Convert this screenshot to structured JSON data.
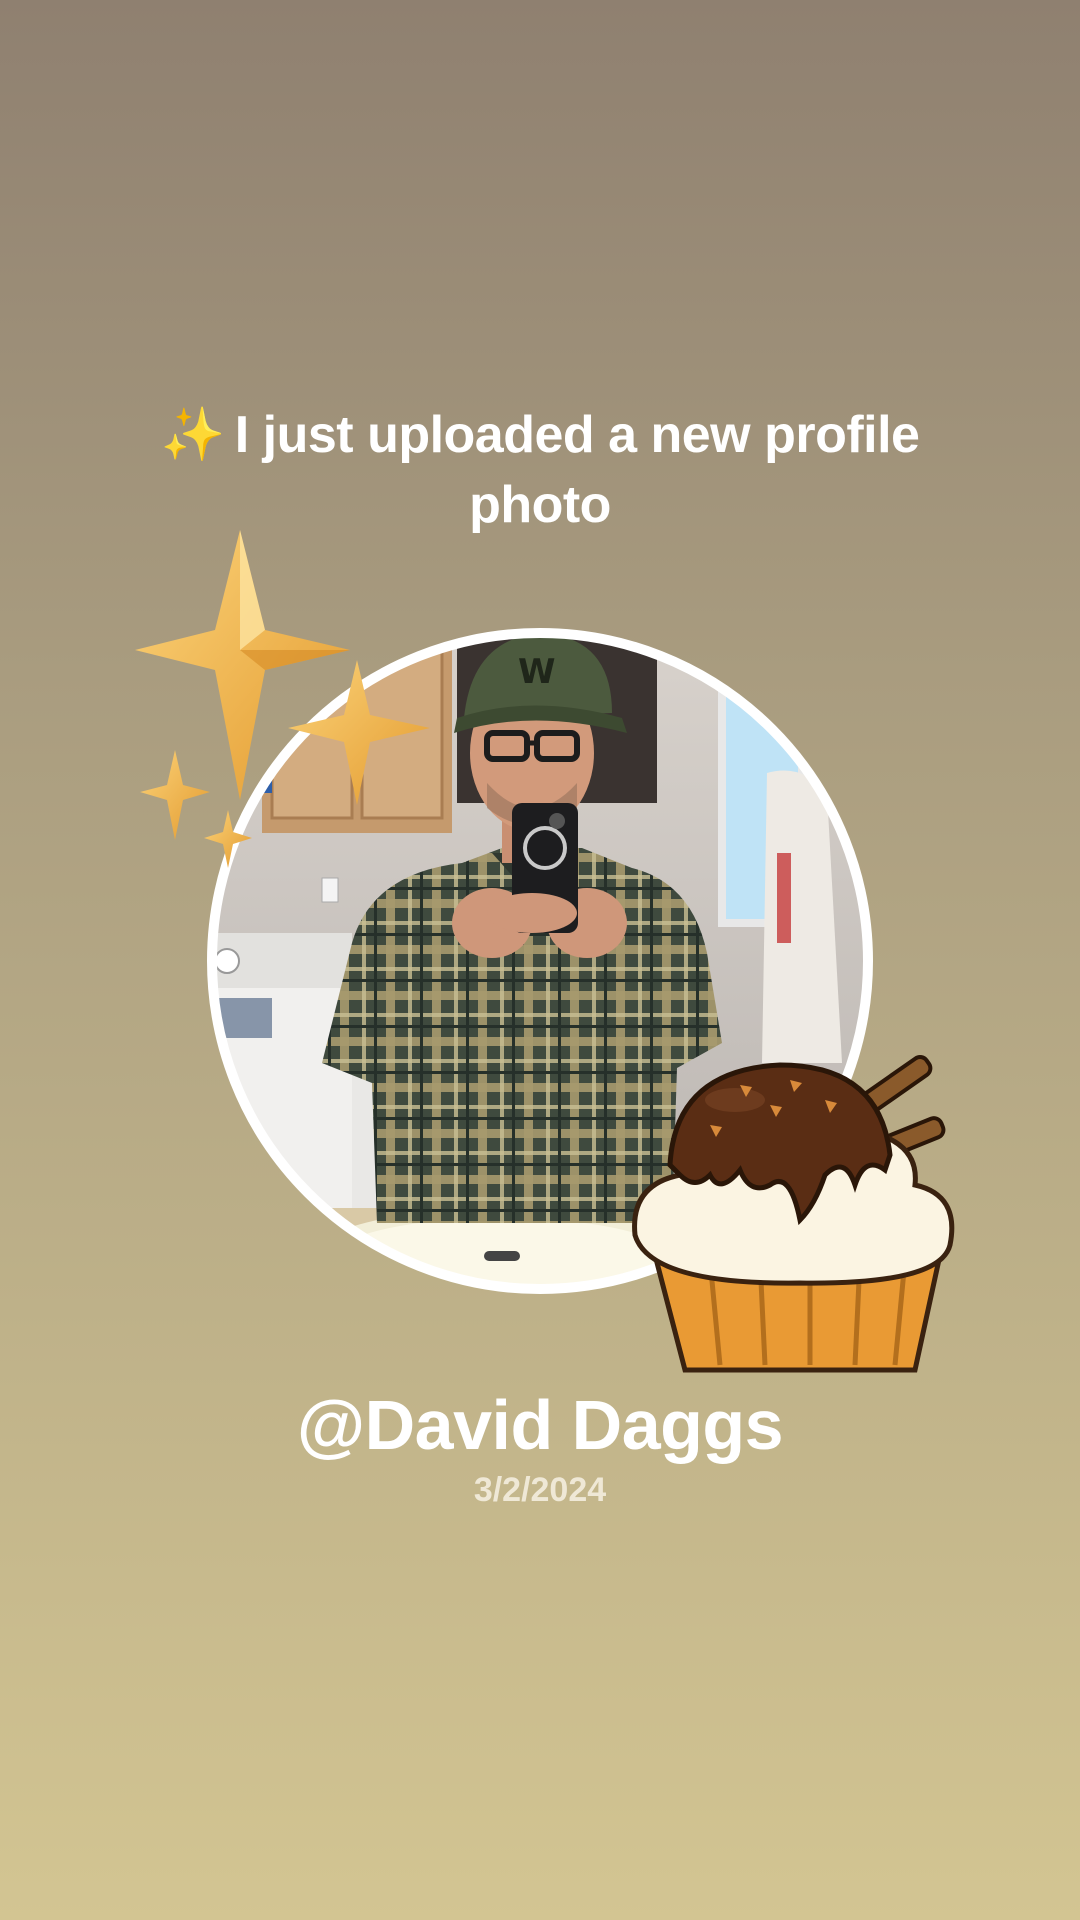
{
  "story": {
    "headline_emoji": "✨",
    "headline": "I just uploaded a new profile photo",
    "username": "@David Daggs",
    "date": "3/2/2024"
  },
  "decorations": {
    "sparkles": "sparkles-icon",
    "cupcake": "cupcake-icon"
  },
  "colors": {
    "background_top": "#8f8070",
    "background_bottom": "#d3c592",
    "ring": "#ffffff",
    "star_gold": "#f0b24a"
  }
}
